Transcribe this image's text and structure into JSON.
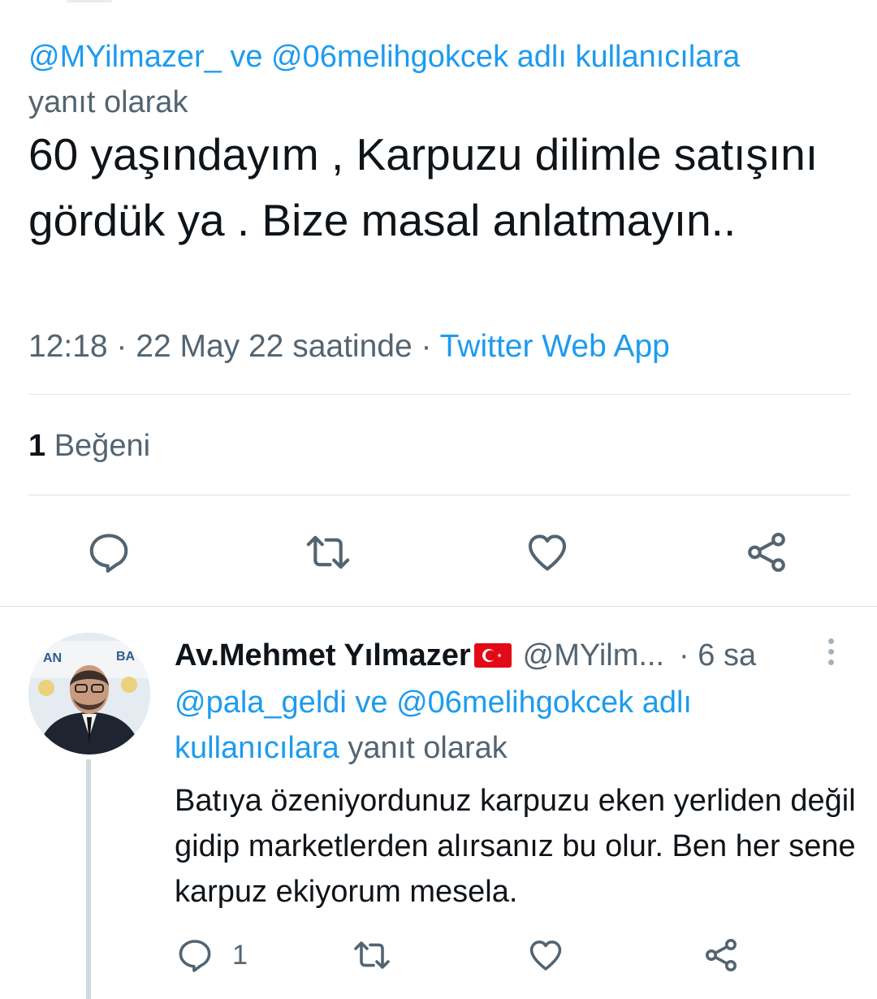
{
  "main_tweet": {
    "reply_context": {
      "mention1": "@MYilmazer_",
      "and": " ve ",
      "mention2": "@06melihgokcek",
      "suffix_link": " adlı kullanıcılara",
      "suffix": "yanıt olarak"
    },
    "text": "60 yaşındayım , Karpuzu dilimle satışını gördük ya . Bize masal anlatmayın..",
    "time": "12:18 · 22 May 22 saatinde ·",
    "source": "Twitter Web App",
    "likes_count": "1",
    "likes_label": "Beğeni",
    "actions": {
      "reply_icon": "comment-icon",
      "retweet_icon": "retweet-icon",
      "like_icon": "heart-icon",
      "share_icon": "share-icon"
    }
  },
  "reply_tweet": {
    "name": "Av.Mehmet Yılmazer",
    "flag_icon": "turkey-flag-icon",
    "handle": "@MYilm...",
    "time": "· 6 sa",
    "reply_context": {
      "mention1": "@pala_geldi",
      "and": " ve ",
      "mention2": "@06melihgokcek",
      "suffix_link": " adlı kullanıcılara",
      "suffix": " yanıt olarak"
    },
    "text": "Batıya özeniyordunuz karpuzu eken yerliden değil gidip marketlerden alırsanız bu olur. Ben her sene karpuz ekiyorum mesela.",
    "reply_count": "1"
  },
  "colors": {
    "link": "#1d9bf0",
    "secondary_text": "#536471",
    "primary_text": "#0f1419",
    "flag_red": "#e30a17"
  }
}
